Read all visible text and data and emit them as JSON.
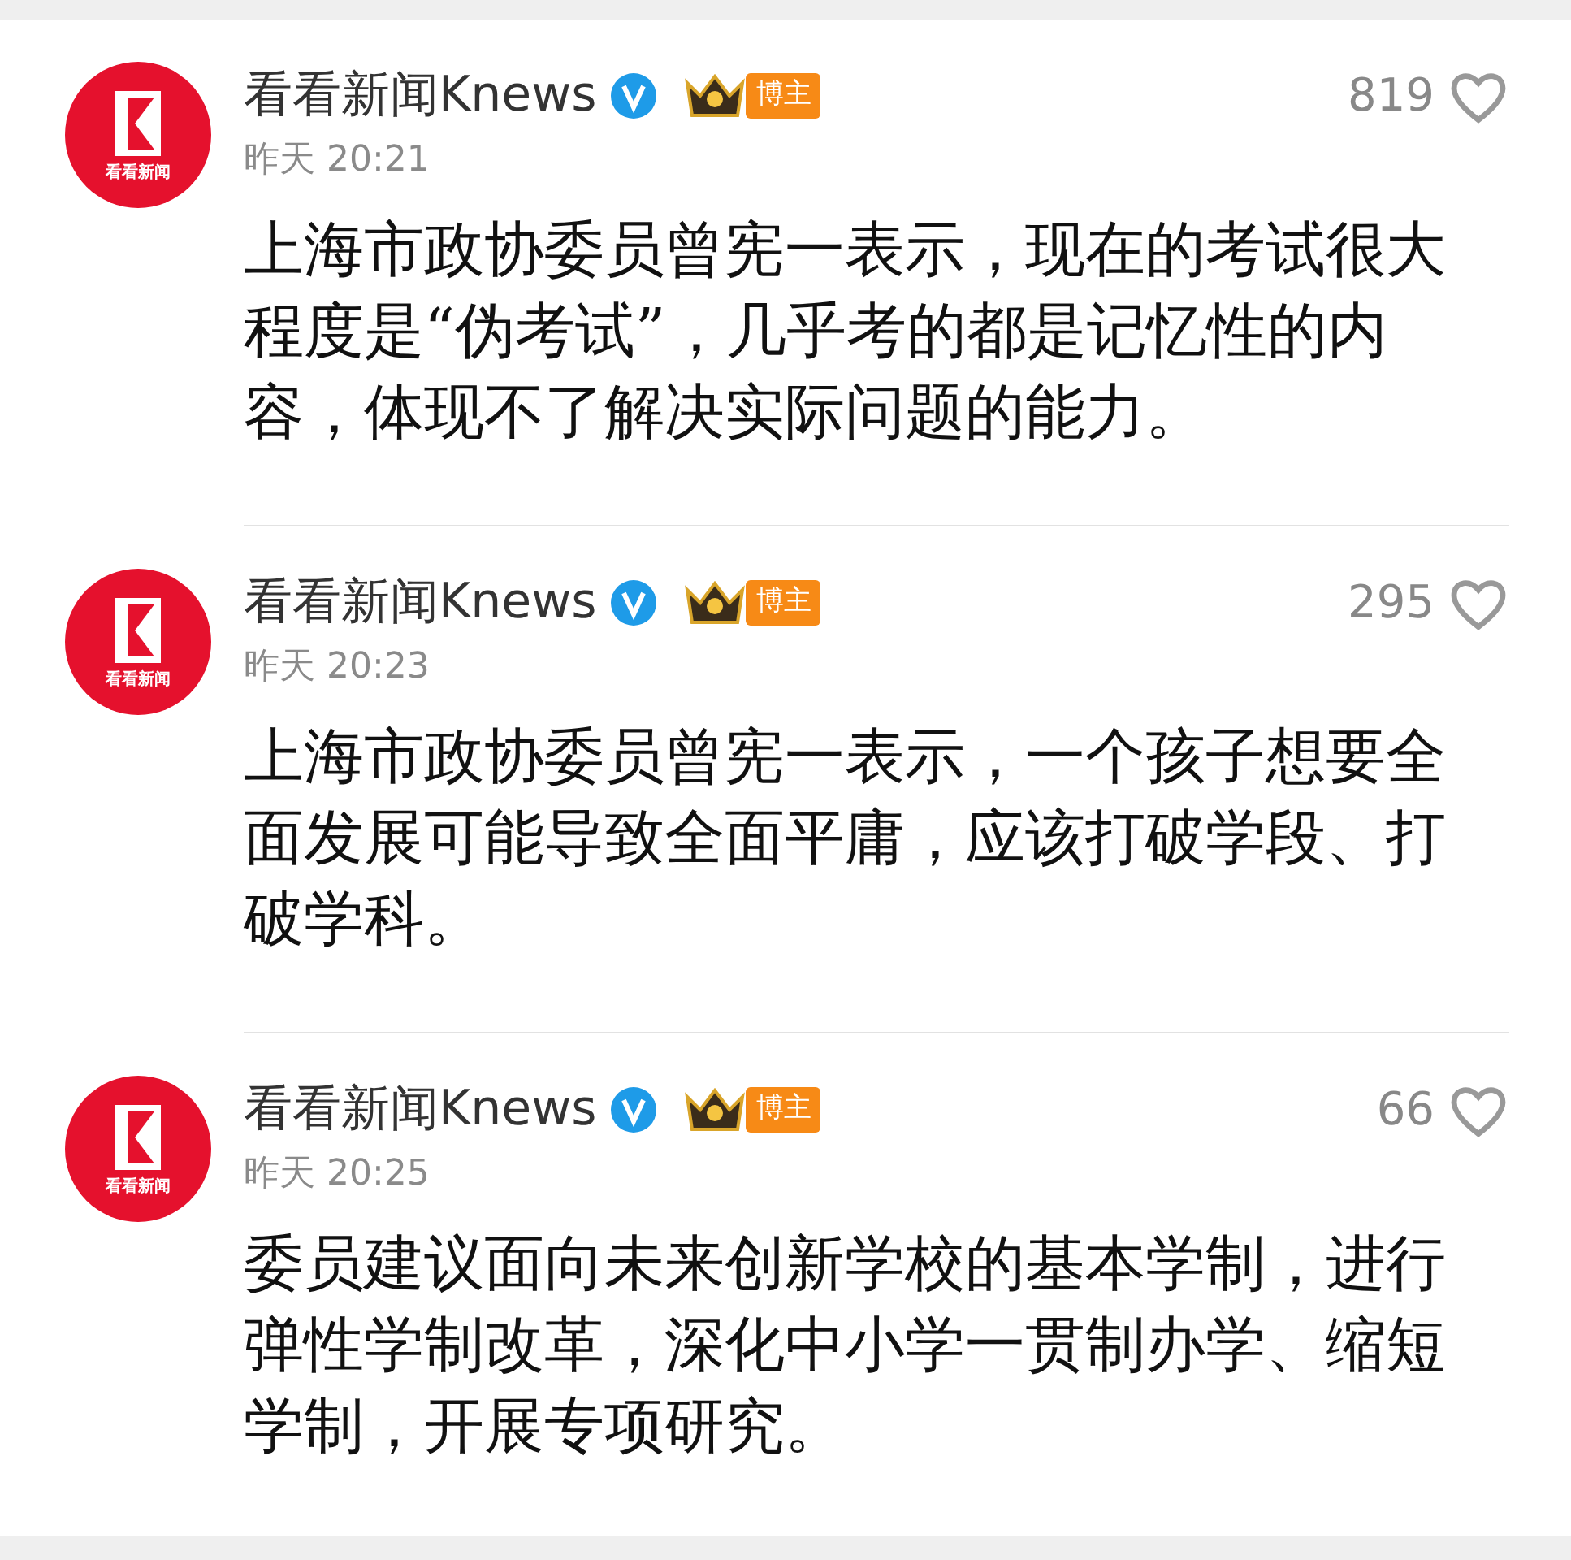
{
  "posts": [
    {
      "avatar_label": "看看新闻",
      "author": "看看新闻Knews",
      "verified": true,
      "badge": "博主",
      "time": "昨天 20:21",
      "likes": "819",
      "liked": false,
      "text": "上海市政协委员曾宪一表示，现在的考试很大程度是“伪考试”，几乎考的都是记忆性的内容，体现不了解决实际问题的能力。"
    },
    {
      "avatar_label": "看看新闻",
      "author": "看看新闻Knews",
      "verified": true,
      "badge": "博主",
      "time": "昨天 20:23",
      "likes": "295",
      "liked": false,
      "text": "上海市政协委员曾宪一表示，一个孩子想要全面发展可能导致全面平庸，应该打破学段、打破学科。"
    },
    {
      "avatar_label": "看看新闻",
      "author": "看看新闻Knews",
      "verified": true,
      "badge": "博主",
      "time": "昨天 20:25",
      "likes": "66",
      "liked": false,
      "text": "委员建议面向未来创新学校的基本学制，进行弹性学制改革，深化中小学一贯制办学、缩短学制，开展专项研究。"
    }
  ]
}
